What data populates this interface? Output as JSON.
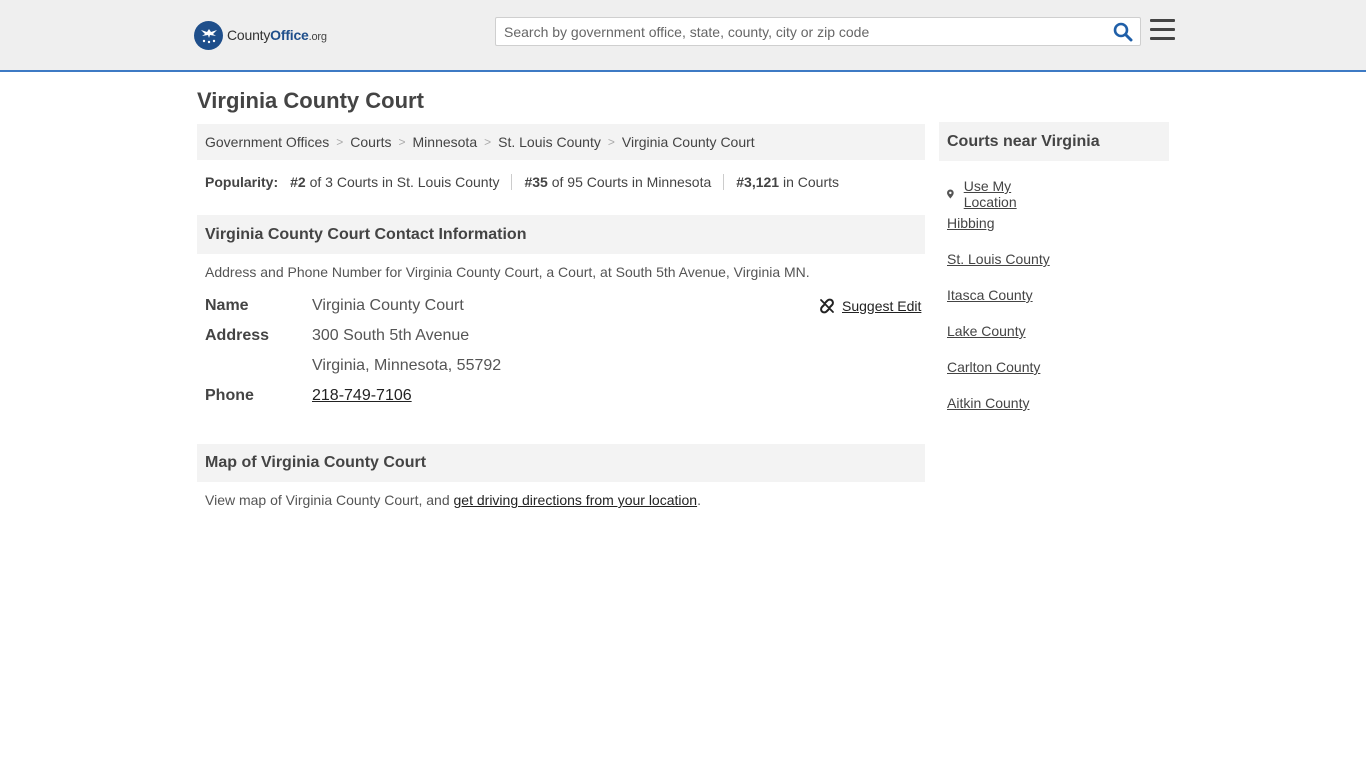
{
  "header": {
    "logo": {
      "brand_a": "County",
      "brand_b": "Office",
      "brand_c": ".org"
    },
    "search_placeholder": "Search by government office, state, county, city or zip code"
  },
  "page_title": "Virginia County Court",
  "breadcrumb": [
    "Government Offices",
    "Courts",
    "Minnesota",
    "St. Louis County",
    "Virginia County Court"
  ],
  "popularity": {
    "label": "Popularity:",
    "items": [
      {
        "rank": "#2",
        "text": "of 3 Courts in St. Louis County"
      },
      {
        "rank": "#35",
        "text": "of 95 Courts in Minnesota"
      },
      {
        "rank": "#3,121",
        "text": "in Courts"
      }
    ]
  },
  "contact": {
    "heading": "Virginia County Court Contact Information",
    "description": "Address and Phone Number for Virginia County Court, a Court, at South 5th Avenue, Virginia MN.",
    "suggest_edit": "Suggest Edit",
    "name_label": "Name",
    "name": "Virginia County Court",
    "address_label": "Address",
    "address_line1": "300 South 5th Avenue",
    "address_line2": "Virginia, Minnesota, 55792",
    "phone_label": "Phone",
    "phone": "218-749-7106"
  },
  "map": {
    "heading": "Map of Virginia County Court",
    "description_prefix": "View map of Virginia County Court, and ",
    "directions_link": "get driving directions from your location",
    "description_suffix": "."
  },
  "sidebar": {
    "heading": "Courts near Virginia",
    "use_location": "Use My Location",
    "links": [
      "Hibbing",
      "St. Louis County",
      "Itasca County",
      "Lake County",
      "Carlton County",
      "Aitkin County"
    ]
  },
  "colors": {
    "accent": "#3d7ac4",
    "brand": "#1f4f8b",
    "header_bg": "#efefef",
    "panel_bg": "#f3f3f3"
  }
}
